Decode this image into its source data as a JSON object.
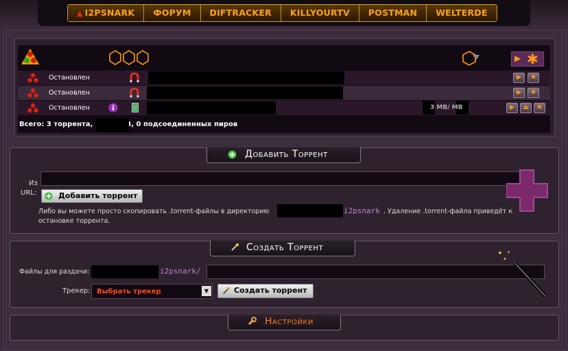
{
  "nav": {
    "items": [
      "I2PSNARK",
      "ФОРУМ",
      "DIFTRACKER",
      "KILLYOURTV",
      "POSTMAN",
      "WELTERDE"
    ]
  },
  "torrents": {
    "rows": [
      {
        "status": "Остановлен",
        "size": ""
      },
      {
        "status": "Остановлен",
        "size": ""
      },
      {
        "status": "Остановлен",
        "size": "3 MB/  MB"
      }
    ],
    "summary": "Всего: 3 торрента,           MB, 0 подсоединенных пиров"
  },
  "add": {
    "title": "Добавить Торрент",
    "from_label": "Из",
    "url_label": "URL:",
    "button": "Добавить торрент",
    "hint_prefix": "Либо вы можете просто скопировать .torrent-файлы в директорию",
    "hint_dir": "i2psnark",
    "hint_suffix": ". Удаление .torrent-файла приведёт к",
    "hint_line2": "остановке торрента."
  },
  "create": {
    "title": "Создать Торрент",
    "files_label": "Файлы для раздачи:",
    "path_suffix": "i2psnark/",
    "tracker_label": "Трекер:",
    "tracker_value": "Выбрать трекер",
    "button": "Создать торрент"
  },
  "settings": {
    "title": "Настройки"
  },
  "colors": {
    "accent": "#ff8c00",
    "purple": "#a050a0",
    "bg": "#3d2e3d"
  }
}
